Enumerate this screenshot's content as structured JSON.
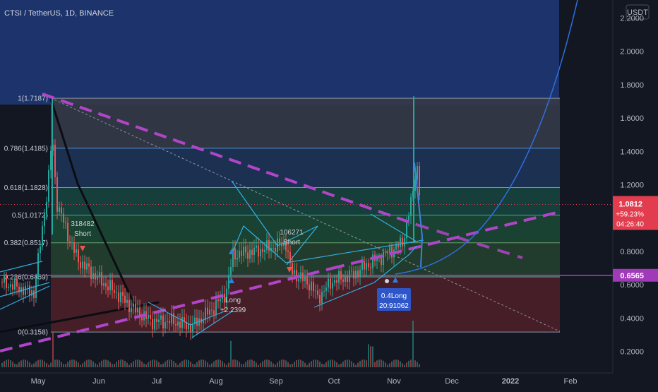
{
  "header": {
    "title": "CTSI / TetherUS, 1D, BINANCE",
    "currency_badge": "USDT"
  },
  "colors": {
    "background": "#131722",
    "upper_zone": "#1e3a78",
    "up_candle": "#26a69a",
    "down_candle": "#ef5350",
    "fib_line": "#9aa3b3",
    "trend_dash": "#b145c8",
    "pattern_line": "#33aee0",
    "curve": "#2f6fe0",
    "last_price_badge": "#e23d4f",
    "support_badge": "#a03ab8",
    "long_badge": "#2f56c9"
  },
  "chart_data": {
    "type": "candlestick",
    "symbol": "CTSI / TetherUS",
    "interval": "1D",
    "exchange": "BINANCE",
    "y_scale": "linear",
    "ylim": [
      0.12,
      2.35
    ],
    "y_ticks": [
      "0.2000",
      "0.4000",
      "0.6000",
      "0.8000",
      "1.0000",
      "1.2000",
      "1.4000",
      "1.6000",
      "1.8000",
      "2.0000",
      "2.2000"
    ],
    "x_ticks": [
      "May",
      "Jun",
      "Jul",
      "Aug",
      "Sep",
      "Oct",
      "Nov",
      "Dec",
      "2022",
      "Feb"
    ],
    "fib_levels": [
      {
        "label": "1(1.7187)",
        "value": 1.7187
      },
      {
        "label": "0.786(1.4185)",
        "value": 1.4185
      },
      {
        "label": "0.618(1.1828)",
        "value": 1.1828
      },
      {
        "label": "0.5(1.0172)",
        "value": 1.0172
      },
      {
        "label": "0.382(0.8517)",
        "value": 0.8517
      },
      {
        "label": "0.236(0.6469)",
        "value": 0.6469
      },
      {
        "label": "0(0.3158)",
        "value": 0.3158
      }
    ],
    "price_badges": {
      "last": {
        "value": "1.0812",
        "change": "+59.23%",
        "countdown": "04:26:40"
      },
      "support": {
        "value": "0.6565"
      }
    },
    "annotations": [
      {
        "id": "short1",
        "lines": [
          "318482",
          "Short"
        ]
      },
      {
        "id": "short2",
        "lines": [
          "106271",
          "Short"
        ]
      },
      {
        "id": "long1",
        "lines": [
          "Long",
          "+2.2399"
        ]
      },
      {
        "id": "long2",
        "lines": [
          "0.4Long",
          "20:91062"
        ]
      }
    ],
    "grid": false
  }
}
